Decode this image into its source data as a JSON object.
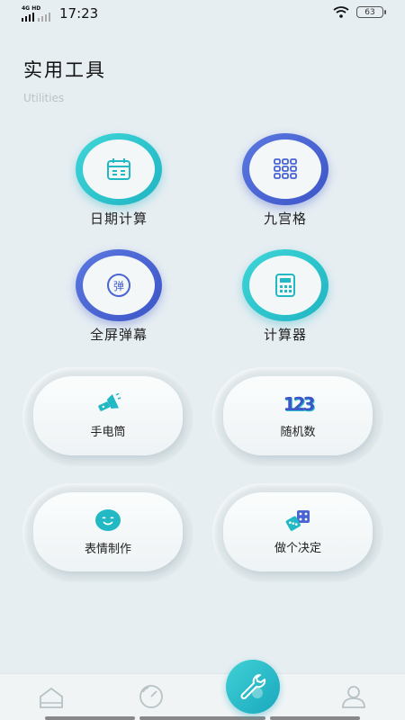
{
  "status_bar": {
    "network": "4G HD",
    "time": "17:23",
    "battery": "63"
  },
  "header": {
    "title": "实用工具",
    "subtitle": "Utilities"
  },
  "tools": [
    {
      "label": "日期计算",
      "icon": "calendar-icon",
      "style": "teal"
    },
    {
      "label": "九宫格",
      "icon": "grid-icon",
      "style": "blue"
    },
    {
      "label": "全屏弹幕",
      "icon": "bullet-comment-icon",
      "style": "blue",
      "icon_text": "弹"
    },
    {
      "label": "计算器",
      "icon": "calculator-icon",
      "style": "teal"
    }
  ],
  "cards": [
    {
      "label": "手电筒",
      "icon": "flashlight-icon"
    },
    {
      "label": "随机数",
      "icon": "random-number-icon",
      "icon_text": "123"
    },
    {
      "label": "表情制作",
      "icon": "smiley-icon"
    },
    {
      "label": "做个决定",
      "icon": "dice-icon"
    }
  ],
  "tab_bar": {
    "items": [
      "home-icon",
      "gauge-icon",
      "tools-icon",
      "profile-icon"
    ],
    "active": "tools-icon"
  },
  "colors": {
    "teal": "#2cc4cc",
    "blue": "#4a64d4",
    "background": "#e6eef2"
  }
}
